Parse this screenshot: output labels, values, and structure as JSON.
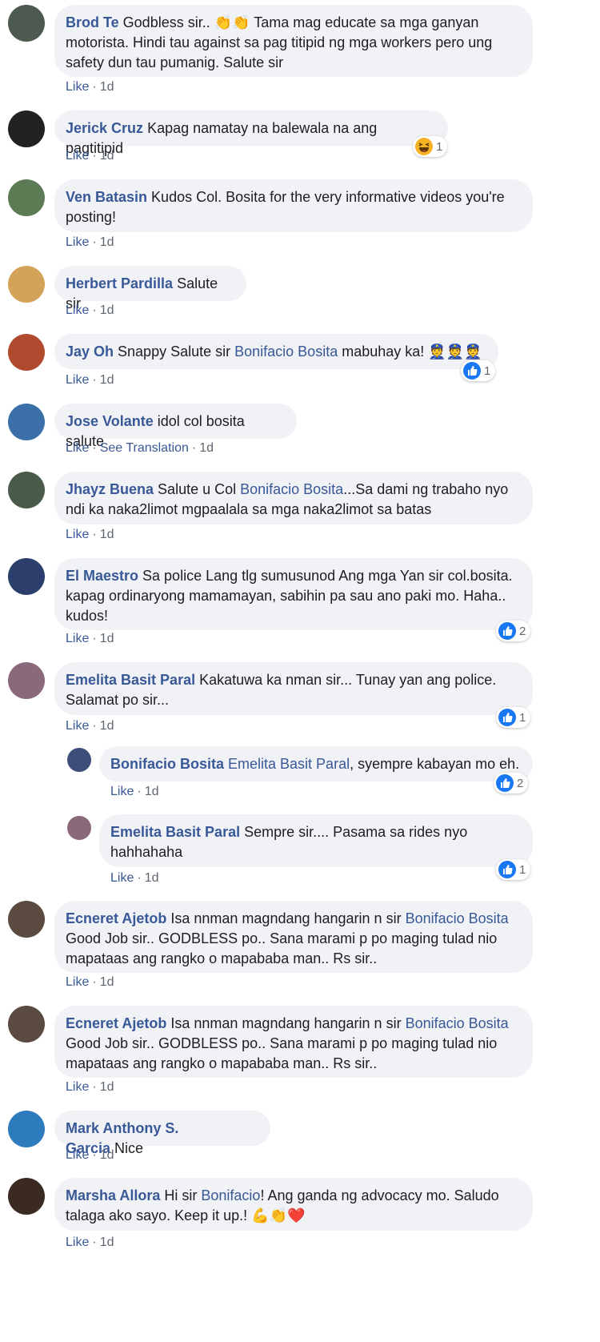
{
  "comments": [
    {
      "name": "Brod Te",
      "segments": [
        {
          "t": "Godbless sir.. 👏👏 Tama mag educate sa mga ganyan motorista. Hindi tau against sa pag titipid ng mga workers pero ung safety dun tau pumanig. Salute sir"
        }
      ],
      "actions": [
        "Like",
        "1d"
      ],
      "reaction": null,
      "avatar_color": "#4d5a4f"
    },
    {
      "name": "Jerick Cruz",
      "segments": [
        {
          "t": "Kapag namatay na balewala na ang pagtitipid"
        }
      ],
      "actions": [
        "Like",
        "1d"
      ],
      "reaction": {
        "type": "haha",
        "count": "1"
      },
      "avatar_color": "#222222"
    },
    {
      "name": "Ven Batasin",
      "segments": [
        {
          "t": "Kudos Col. Bosita for the very informative videos you're posting!"
        }
      ],
      "actions": [
        "Like",
        "1d"
      ],
      "reaction": null,
      "avatar_color": "#5c7a54"
    },
    {
      "name": "Herbert Pardilla",
      "segments": [
        {
          "t": "Salute sir"
        }
      ],
      "actions": [
        "Like",
        "1d"
      ],
      "reaction": null,
      "avatar_color": "#d4a35a"
    },
    {
      "name": "Jay Oh",
      "segments": [
        {
          "t": "Snappy Salute sir "
        },
        {
          "m": "Bonifacio Bosita"
        },
        {
          "t": " mabuhay ka! 👮👮👮"
        }
      ],
      "actions": [
        "Like",
        "1d"
      ],
      "reaction": {
        "type": "like",
        "count": "1"
      },
      "avatar_color": "#b04a2e"
    },
    {
      "name": "Jose Volante",
      "segments": [
        {
          "t": "idol col bosita salute"
        }
      ],
      "actions": [
        "Like",
        "See Translation",
        "1d"
      ],
      "reaction": null,
      "avatar_color": "#3b6fa8"
    },
    {
      "name": "Jhayz Buena",
      "segments": [
        {
          "t": "Salute u Col "
        },
        {
          "m": "Bonifacio Bosita"
        },
        {
          "t": "...Sa dami ng trabaho nyo ndi ka naka2limot mgpaalala sa mga naka2limot sa batas"
        }
      ],
      "actions": [
        "Like",
        "1d"
      ],
      "reaction": null,
      "avatar_color": "#4a5b4c"
    },
    {
      "name": "El Maestro",
      "segments": [
        {
          "t": "Sa police Lang tlg sumusunod Ang mga Yan sir col.bosita. kapag ordinaryong mamamayan, sabihin pa sau ano paki mo. Haha.. kudos!"
        }
      ],
      "actions": [
        "Like",
        "1d"
      ],
      "reaction": {
        "type": "like",
        "count": "2"
      },
      "avatar_color": "#2c3e6b"
    },
    {
      "name": "Emelita Basit Paral",
      "segments": [
        {
          "t": "Kakatuwa ka nman sir... Tunay yan ang police. Salamat po sir..."
        }
      ],
      "actions": [
        "Like",
        "1d"
      ],
      "reaction": {
        "type": "like",
        "count": "1"
      },
      "avatar_color": "#8a6a7a"
    },
    {
      "name": "Bonifacio Bosita",
      "segments": [
        {
          "m": "Emelita Basit Paral"
        },
        {
          "t": ", syempre kabayan mo eh."
        }
      ],
      "actions": [
        "Like",
        "1d"
      ],
      "reaction": {
        "type": "like",
        "count": "2"
      },
      "avatar_color": "#3c4e7a",
      "reply": true
    },
    {
      "name": "Emelita Basit Paral",
      "segments": [
        {
          "t": "Sempre sir.... Pasama sa rides nyo hahhahaha"
        }
      ],
      "actions": [
        "Like",
        "1d"
      ],
      "reaction": {
        "type": "like",
        "count": "1"
      },
      "avatar_color": "#8a6a7a",
      "reply": true
    },
    {
      "name": "Ecneret Ajetob",
      "segments": [
        {
          "t": "Isa nnman magndang hangarin n sir "
        },
        {
          "m": "Bonifacio Bosita"
        },
        {
          "t": " Good Job sir.. GODBLESS po.. Sana marami p po maging tulad nio mapataas ang rangko o mapababa man.. Rs sir.."
        }
      ],
      "actions": [
        "Like",
        "1d"
      ],
      "reaction": null,
      "avatar_color": "#5a4a40"
    },
    {
      "name": "Ecneret Ajetob",
      "segments": [
        {
          "t": "Isa nnman magndang hangarin n sir "
        },
        {
          "m": "Bonifacio Bosita"
        },
        {
          "t": " Good Job sir.. GODBLESS po.. Sana marami p po maging tulad nio mapataas ang rangko o mapababa man.. Rs sir.."
        }
      ],
      "actions": [
        "Like",
        "1d"
      ],
      "reaction": null,
      "avatar_color": "#5a4a40"
    },
    {
      "name": "Mark Anthony S. Garcia",
      "segments": [
        {
          "t": "Nice"
        }
      ],
      "actions": [
        "Like",
        "1d"
      ],
      "reaction": null,
      "avatar_color": "#2d7bbd"
    },
    {
      "name": "Marsha Allora",
      "segments": [
        {
          "t": "Hi sir "
        },
        {
          "m": "Bonifacio"
        },
        {
          "t": "! Ang ganda ng advocacy mo. Saludo talaga ako sayo. Keep it up.! 💪👏❤️"
        }
      ],
      "actions": [
        "Like",
        "1d"
      ],
      "reaction": null,
      "avatar_color": "#3a2a22"
    }
  ]
}
